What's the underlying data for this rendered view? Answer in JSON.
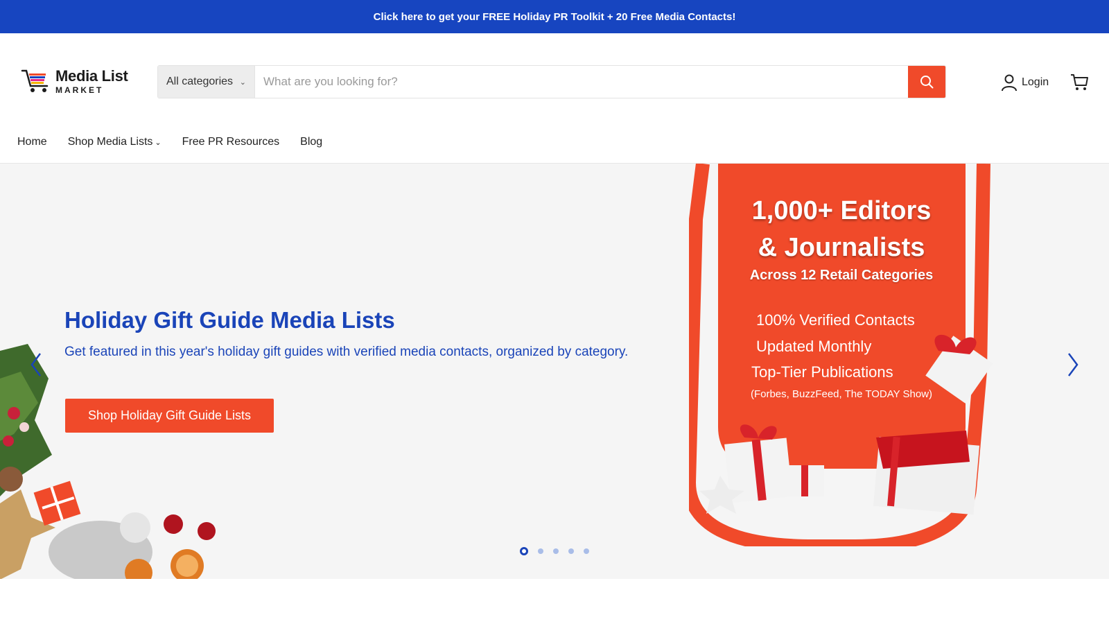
{
  "announcement": {
    "text": "Click here to get your FREE Holiday PR Toolkit + 20 Free Media Contacts!"
  },
  "logo": {
    "name": "Media List",
    "sub": "MARKET"
  },
  "search": {
    "category": "All categories",
    "placeholder": "What are you looking for?"
  },
  "account": {
    "login_label": "Login"
  },
  "nav": {
    "home": "Home",
    "shop": "Shop Media Lists",
    "resources": "Free PR Resources",
    "blog": "Blog"
  },
  "hero": {
    "title": "Holiday Gift Guide Media Lists",
    "subtitle": "Get featured in this year's holiday gift guides with verified media contacts, organized by category.",
    "cta": "Shop Holiday Gift Guide Lists",
    "slide_count": 5,
    "active_slide": 1
  },
  "promo": {
    "headline_1": "1,000+ Editors",
    "headline_2": "& Journalists",
    "subhead": "Across 12 Retail Categories",
    "bullets": [
      "100% Verified Contacts",
      "Updated Monthly",
      "Top-Tier Publications"
    ],
    "note": "(Forbes, BuzzFeed, The TODAY Show)"
  },
  "colors": {
    "brand_blue": "#1745c0",
    "accent_orange": "#f04a2a",
    "hero_bg": "#f5f5f5"
  },
  "icons": [
    "search-icon",
    "user-icon",
    "cart-icon",
    "chevron-left-icon",
    "chevron-right-icon",
    "chevron-down-icon"
  ]
}
